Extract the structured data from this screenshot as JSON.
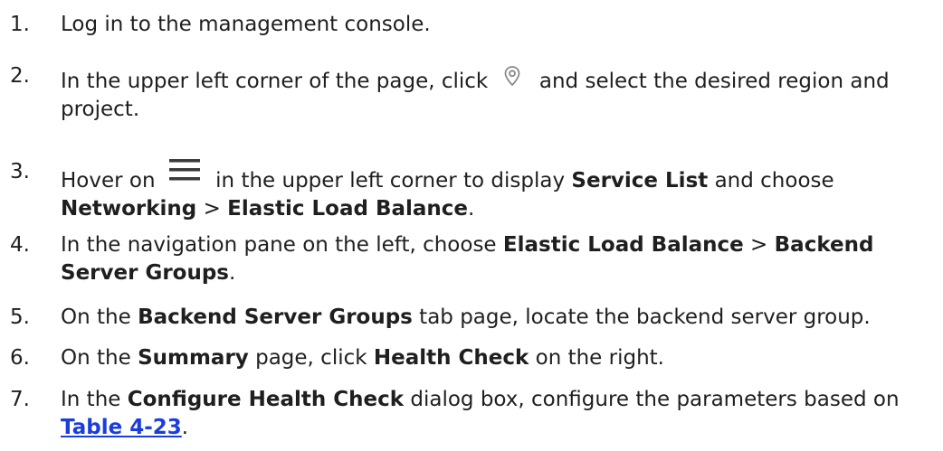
{
  "steps": [
    {
      "num": "1.",
      "segments": [
        {
          "t": "text",
          "v": "Log in to the management console."
        }
      ]
    },
    {
      "num": "2.",
      "segments": [
        {
          "t": "text",
          "v": "In the upper left corner of the page, click "
        },
        {
          "t": "icon",
          "icon": "location-pin-icon"
        },
        {
          "t": "text",
          "v": " and select the desired region and project."
        }
      ]
    },
    {
      "num": "3.",
      "segments": [
        {
          "t": "text",
          "v": "Hover on "
        },
        {
          "t": "icon",
          "icon": "menu-icon"
        },
        {
          "t": "text",
          "v": " in the upper left corner to display "
        },
        {
          "t": "bold",
          "v": "Service List"
        },
        {
          "t": "text",
          "v": " and choose "
        },
        {
          "t": "bold",
          "v": "Networking"
        },
        {
          "t": "text",
          "v": " > "
        },
        {
          "t": "bold",
          "v": "Elastic Load Balance"
        },
        {
          "t": "text",
          "v": "."
        }
      ]
    },
    {
      "num": "4.",
      "segments": [
        {
          "t": "text",
          "v": "In the navigation pane on the left, choose "
        },
        {
          "t": "bold",
          "v": "Elastic Load Balance"
        },
        {
          "t": "text",
          "v": " > "
        },
        {
          "t": "bold",
          "v": "Backend Server Groups"
        },
        {
          "t": "text",
          "v": "."
        }
      ]
    },
    {
      "num": "5.",
      "segments": [
        {
          "t": "text",
          "v": "On the "
        },
        {
          "t": "bold",
          "v": "Backend Server Groups"
        },
        {
          "t": "text",
          "v": " tab page, locate the backend server group."
        }
      ]
    },
    {
      "num": "6.",
      "segments": [
        {
          "t": "text",
          "v": "On the "
        },
        {
          "t": "bold",
          "v": "Summary"
        },
        {
          "t": "text",
          "v": " page, click "
        },
        {
          "t": "bold",
          "v": "Health Check"
        },
        {
          "t": "text",
          "v": " on the right."
        }
      ]
    },
    {
      "num": "7.",
      "segments": [
        {
          "t": "text",
          "v": "In the "
        },
        {
          "t": "bold",
          "v": "Configure Health Check"
        },
        {
          "t": "text",
          "v": " dialog box, configure the parameters based on "
        },
        {
          "t": "link",
          "v": "Table 4-23"
        },
        {
          "t": "text",
          "v": "."
        }
      ]
    }
  ],
  "colors": {
    "text": "#1f1f1f",
    "link": "#1a3dde",
    "icon_gray": "#8a8a8a",
    "icon_dark": "#3a3a3a"
  }
}
